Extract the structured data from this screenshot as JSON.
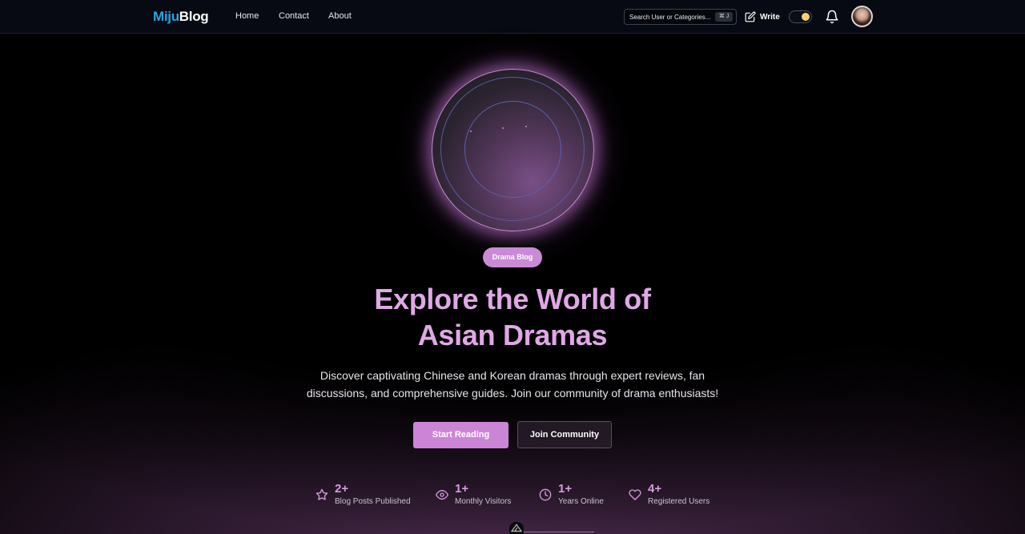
{
  "nav": {
    "logo_part1": "Miju",
    "logo_part2": "Blog",
    "links": [
      "Home",
      "Contact",
      "About"
    ],
    "search_placeholder": "Search User or Categories...",
    "search_shortcut": "⌘ J",
    "write_label": "Write"
  },
  "hero": {
    "badge": "Drama Blog",
    "title_line1": "Explore the World of",
    "title_line2": "Asian Dramas",
    "description": "Discover captivating Chinese and Korean dramas through expert reviews, fan discussions, and comprehensive guides. Join our community of drama enthusiasts!",
    "primary_button": "Start Reading",
    "secondary_button": "Join Community"
  },
  "stats": [
    {
      "value": "2+",
      "label": "Blog Posts Published",
      "icon": "star-icon"
    },
    {
      "value": "1+",
      "label": "Monthly Visitors",
      "icon": "eye-icon"
    },
    {
      "value": "1+",
      "label": "Years Online",
      "icon": "clock-icon"
    },
    {
      "value": "4+",
      "label": "Registered Users",
      "icon": "heart-icon"
    }
  ],
  "colors": {
    "accent": "#cc85d6",
    "title": "#e0a8e6",
    "logo_blue": "#2aa4e0",
    "nav_bg": "#070a12"
  }
}
